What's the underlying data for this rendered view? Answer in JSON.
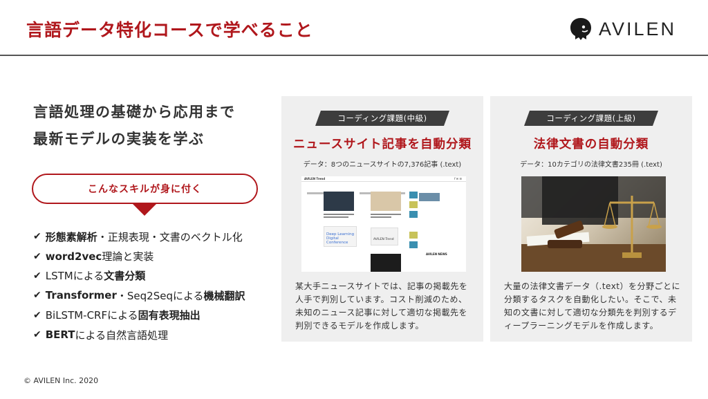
{
  "header": {
    "title": "言語データ特化コースで学べること",
    "logo_text": "AVILEN"
  },
  "left": {
    "headline_line1": "言語処理の基礎から応用まで",
    "headline_line2": "最新モデルの実装を学ぶ",
    "skill_label": "こんなスキルが身に付く",
    "skills": [
      {
        "check": "✔",
        "bold": "形態素解析",
        "rest": "・正規表現・文書のベクトル化"
      },
      {
        "check": "✔",
        "bold": "word2vec",
        "rest": "理論と実装"
      },
      {
        "check": "✔",
        "pre": "LSTMによる",
        "bold": "文書分類"
      },
      {
        "check": "✔",
        "bold": "Transformer",
        "mid": "・Seq2Seqによる",
        "bold2": "機械翻訳"
      },
      {
        "check": "✔",
        "pre": "BiLSTM-CRFによる",
        "bold": "固有表現抽出"
      },
      {
        "check": "✔",
        "bold": "BERT",
        "rest": "による自然言語処理"
      }
    ]
  },
  "cards": [
    {
      "tag": "コーディング課題(中級)",
      "title": "ニュースサイト記事を自動分類",
      "data": "データ：8つのニュースサイトの7,376記事 (.text)",
      "description": "某大手ニュースサイトでは、記事の掲載先を人手で判別しています。コスト削減のため、未知のニュース記事に対して適切な掲載先を判別できるモデルを作成します。",
      "image_text": {
        "brand": "AVILEN Trend",
        "dl_title": "Deep Learning Digital Conference",
        "chip": "AVILEN Trend",
        "news": "AVILEN NEWS"
      }
    },
    {
      "tag": "コーディング課題(上級)",
      "title": "法律文書の自動分類",
      "data": "データ：10カテゴリの法律文書235冊 (.text)",
      "description": "大量の法律文書データ（.text）を分野ごとに分類するタスクを自動化したい。そこで、未知の文書に対して適切な分類先を判別するディープラーニングモデルを作成します。"
    }
  ],
  "footer": {
    "copyright": "© AVILEN Inc. 2020"
  },
  "colors": {
    "accent": "#b0171c",
    "card_bg": "#efefef",
    "tag_bg": "#3d3d3d"
  }
}
